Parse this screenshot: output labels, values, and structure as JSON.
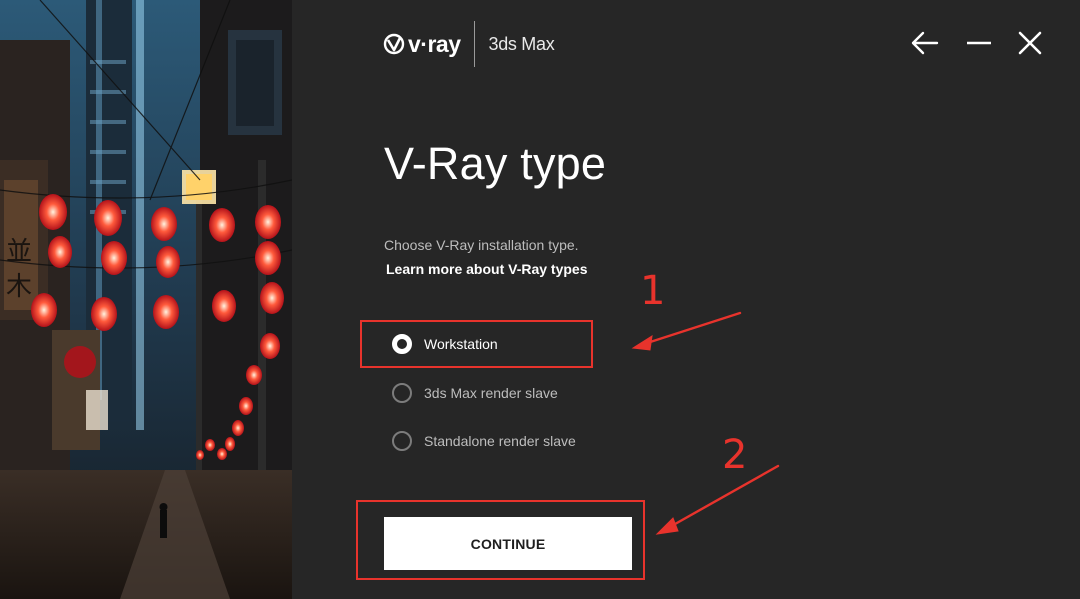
{
  "header": {
    "logo_text": "v·ray",
    "product": "3ds Max"
  },
  "window_controls": [
    "back-arrow-icon",
    "minimize-icon",
    "close-icon"
  ],
  "main": {
    "title": "V-Ray type",
    "subtitle": "Choose V-Ray installation type.",
    "learn_more": "Learn more about V-Ray types",
    "options": [
      {
        "label": "Workstation",
        "selected": true
      },
      {
        "label": "3ds Max render slave",
        "selected": false
      },
      {
        "label": "Standalone render slave",
        "selected": false
      }
    ],
    "continue_label": "CONTINUE"
  },
  "annotations": {
    "step1": "1",
    "step2": "2"
  },
  "colors": {
    "background": "#262626",
    "button": "#ffffff",
    "annotation": "#e8332c"
  }
}
